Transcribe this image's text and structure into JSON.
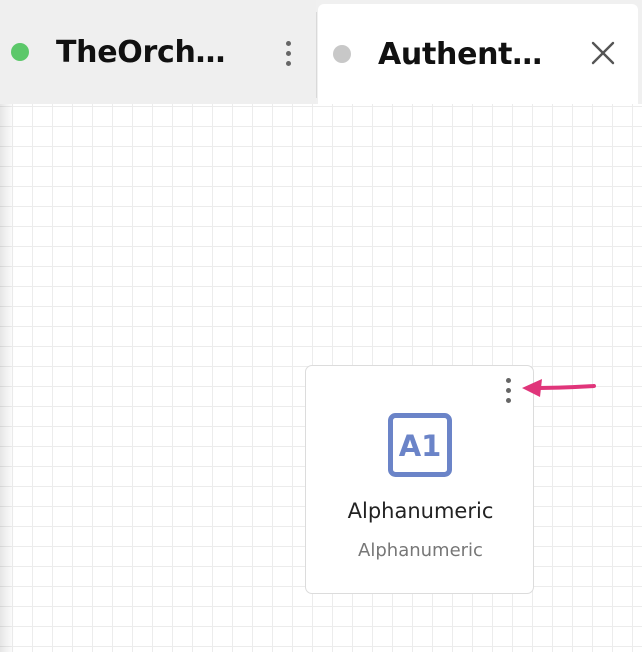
{
  "colors": {
    "tab_1_status": "#5cc86a",
    "tab_2_status": "#c8c8c8",
    "icon_accent": "#6b84c8",
    "annotation_arrow": "#e0357a"
  },
  "tabs": [
    {
      "title": "TheOrchestrator",
      "status": "active-green",
      "menu_icon": "kebab-menu-icon"
    },
    {
      "title": "Authentication",
      "status": "inactive-gray",
      "close_icon": "close-icon"
    }
  ],
  "canvas": {
    "node_card": {
      "icon_text": "A1",
      "icon": "alphanumeric-icon",
      "title": "Alphanumeric",
      "subtitle": "Alphanumeric",
      "menu_icon": "kebab-menu-icon"
    }
  },
  "annotation": {
    "icon": "arrow-left-icon"
  }
}
